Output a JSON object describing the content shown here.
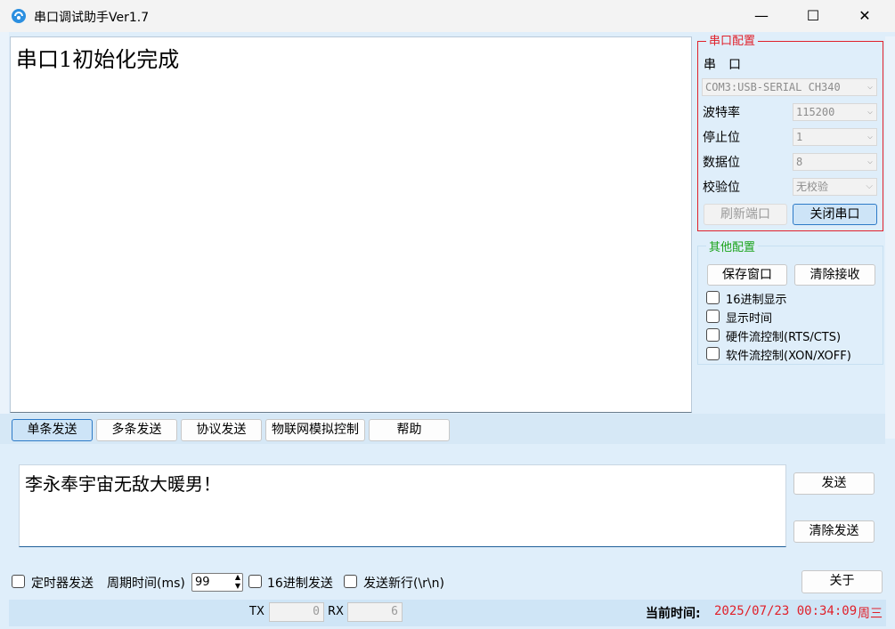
{
  "window": {
    "title": "串口调试助手Ver1.7",
    "minimize_glyph": "—",
    "maximize_glyph": "☐",
    "close_glyph": "✕"
  },
  "receive": {
    "text": "串口1初始化完成"
  },
  "serial_config": {
    "legend": "串口配置",
    "port_label": "串　口",
    "port_value": "COM3:USB-SERIAL CH340",
    "baud_label": "波特率",
    "baud_value": "115200",
    "stop_label": "停止位",
    "stop_value": "1",
    "data_label": "数据位",
    "data_value": "8",
    "parity_label": "校验位",
    "parity_value": "无校验",
    "refresh_button": "刷新端口",
    "close_port_button": "关闭串口"
  },
  "other_config": {
    "legend": "其他配置",
    "save_button": "保存窗口",
    "clear_recv_button": "清除接收",
    "hex_display": "16进制显示",
    "show_time": "显示时间",
    "hw_flow": "硬件流控制(RTS/CTS)",
    "sw_flow": "软件流控制(XON/XOFF)"
  },
  "tabs": [
    {
      "label": "单条发送",
      "selected": true
    },
    {
      "label": "多条发送",
      "selected": false
    },
    {
      "label": "协议发送",
      "selected": false
    },
    {
      "label": "物联网模拟控制",
      "selected": false
    },
    {
      "label": "帮助",
      "selected": false
    }
  ],
  "send": {
    "text": "李永奉宇宙无敌大暖男！",
    "send_button": "发送",
    "clear_send_button": "清除发送"
  },
  "bottom": {
    "timer_send": "定时器发送",
    "period_label": "周期时间(ms)",
    "period_value": "99",
    "hex_send": "16进制发送",
    "send_newline": "发送新行(\\r\\n)",
    "about_button": "关于",
    "tx_label": "TX",
    "tx_value": "0",
    "rx_label": "RX",
    "rx_value": "6",
    "time_label": "当前时间:",
    "time_value": "2025/07/23 00:34:09",
    "weekday": "周三"
  },
  "colors": {
    "accent_red": "#e0202a",
    "other_green": "#1aa31a",
    "time_red": "#e0202a"
  }
}
